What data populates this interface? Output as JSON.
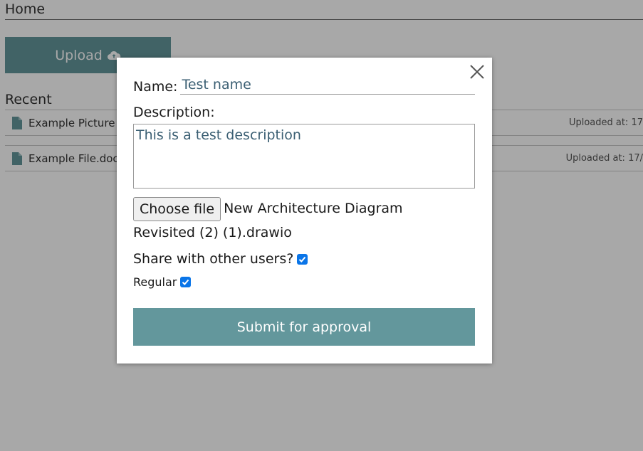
{
  "page": {
    "title": "Home",
    "upload_label": "Upload",
    "recent_title": "Recent",
    "recent_items": [
      {
        "name": "Example Picture",
        "uploaded": "Uploaded at: 17"
      },
      {
        "name": "Example File.doc",
        "uploaded": "Uploaded at: 17/"
      }
    ]
  },
  "modal": {
    "name_label": "Name:",
    "name_value": "Test name",
    "description_label": "Description:",
    "description_value": "This is a test description",
    "choose_file_label": "Choose file",
    "selected_file": "New Architecture Diagram Revisited (2) (1).drawio",
    "share_label": "Share with other users?",
    "share_checked": true,
    "regular_label": "Regular",
    "regular_checked": true,
    "submit_label": "Submit for approval"
  },
  "colors": {
    "accent": "#63979c",
    "checkbox": "#0a75e8",
    "input_text": "#3b5f73"
  },
  "icons": [
    "cloud-upload-icon",
    "file-icon",
    "close-icon",
    "checkmark-icon"
  ]
}
